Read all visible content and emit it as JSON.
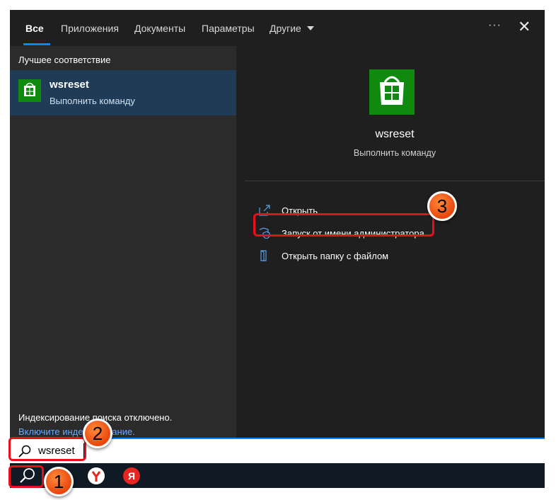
{
  "tabs": [
    {
      "label": "Все",
      "active": true
    },
    {
      "label": "Приложения"
    },
    {
      "label": "Документы"
    },
    {
      "label": "Параметры"
    },
    {
      "label": "Другие"
    }
  ],
  "more_label": "···",
  "close_label": "✕",
  "left": {
    "section_title": "Лучшее соответствие",
    "result": {
      "name": "wsreset",
      "subtitle": "Выполнить команду"
    },
    "index_notice": "Индексирование поиска отключено.",
    "index_link": "Включите индексирование."
  },
  "right": {
    "app_title": "wsreset",
    "app_subtitle": "Выполнить команду",
    "actions": [
      {
        "label": "Открыть",
        "icon": "open-icon"
      },
      {
        "label": "Запуск от имени администратора",
        "icon": "shield-icon"
      },
      {
        "label": "Открыть папку с файлом",
        "icon": "folder-icon"
      }
    ]
  },
  "search": {
    "value": "wsreset"
  },
  "taskbar": {
    "apps": [
      "yandex-browser-icon",
      "yandex-icon"
    ],
    "yandex_letter": "Я"
  },
  "badges": [
    "1",
    "2",
    "3"
  ],
  "colors": {
    "accent": "#0a84ff",
    "store_green": "#0f8a0f",
    "highlight": "#e8101a",
    "badge": "#e8470f"
  }
}
